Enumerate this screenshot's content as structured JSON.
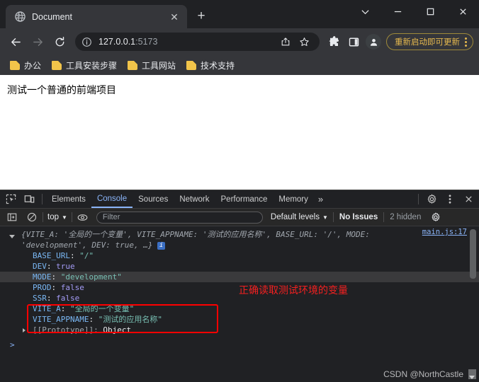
{
  "window": {
    "controls": {
      "minimize_tabsearch": "v",
      "minimize": "—",
      "maximize": "□",
      "close": "✕"
    }
  },
  "tabstrip": {
    "tab_title": "Document",
    "close_label": "✕",
    "new_tab_label": "+"
  },
  "toolbar": {
    "back": "←",
    "forward": "→",
    "reload": "⟳",
    "url_host": "127.0.0.1",
    "url_port": ":5173",
    "share_icon": "share-icon",
    "bookmark_star": "☆",
    "extensions_icon": "puzzle-icon",
    "sidepanel_icon": "side-panel-icon",
    "profile_icon": "person-icon",
    "update_label": "重新启动即可更新",
    "menu_icon": "kebab-menu-icon"
  },
  "bookmarks": [
    {
      "label": "办公"
    },
    {
      "label": "工具安装步骤"
    },
    {
      "label": "工具网站"
    },
    {
      "label": "技术支持"
    }
  ],
  "page": {
    "heading": "测试一个普通的前端项目"
  },
  "devtools": {
    "inspect_icon": "inspect-element-icon",
    "device_icon": "device-toolbar-icon",
    "tabs": [
      {
        "label": "Elements",
        "active": false
      },
      {
        "label": "Console",
        "active": true
      },
      {
        "label": "Sources",
        "active": false
      },
      {
        "label": "Network",
        "active": false
      },
      {
        "label": "Performance",
        "active": false
      },
      {
        "label": "Memory",
        "active": false
      }
    ],
    "more_tabs": "»",
    "settings_icon": "gear-icon",
    "dots_icon": "kebab-menu-icon",
    "close_icon": "✕",
    "filterbar": {
      "sidebar_icon": "console-sidebar-icon",
      "clear_icon": "clear-console-icon",
      "context": "top",
      "context_caret": "▼",
      "eye_icon": "live-expression-icon",
      "filter_placeholder": "Filter",
      "filter_value": "",
      "levels": "Default levels",
      "levels_caret": "▼",
      "issues": "No Issues",
      "hidden": "2 hidden",
      "settings_icon": "gear-icon"
    },
    "console": {
      "source_link": "main.js:17",
      "preview_line1_prefix": "{",
      "preview": [
        {
          "key": "VITE_A",
          "value": "'全局的一个变量'"
        },
        {
          "key": "VITE_APPNAME",
          "value": "'测试的应用名称'"
        },
        {
          "key": "BASE_URL",
          "value": "'/'"
        },
        {
          "key": "MODE",
          "value": "'development'"
        },
        {
          "key": "DEV",
          "value": "true"
        }
      ],
      "preview_ellipsis": "…}",
      "info_badge": "i",
      "properties": [
        {
          "key": "BASE_URL",
          "value": "\"/\"",
          "type": "string",
          "selected": false
        },
        {
          "key": "DEV",
          "value": "true",
          "type": "bool",
          "selected": false
        },
        {
          "key": "MODE",
          "value": "\"development\"",
          "type": "string",
          "selected": true
        },
        {
          "key": "PROD",
          "value": "false",
          "type": "bool",
          "selected": false
        },
        {
          "key": "SSR",
          "value": "false",
          "type": "bool",
          "selected": false
        },
        {
          "key": "VITE_A",
          "value": "\"全局的一个变量\"",
          "type": "string",
          "selected": false
        },
        {
          "key": "VITE_APPNAME",
          "value": "\"测试的应用名称\"",
          "type": "string",
          "selected": false
        }
      ],
      "prototype_label": "[[Prototype]]:",
      "prototype_value": "Object",
      "prompt_caret": ">",
      "annotation": "正确读取测试环境的变量"
    }
  },
  "watermark": "CSDN @NorthCastle"
}
